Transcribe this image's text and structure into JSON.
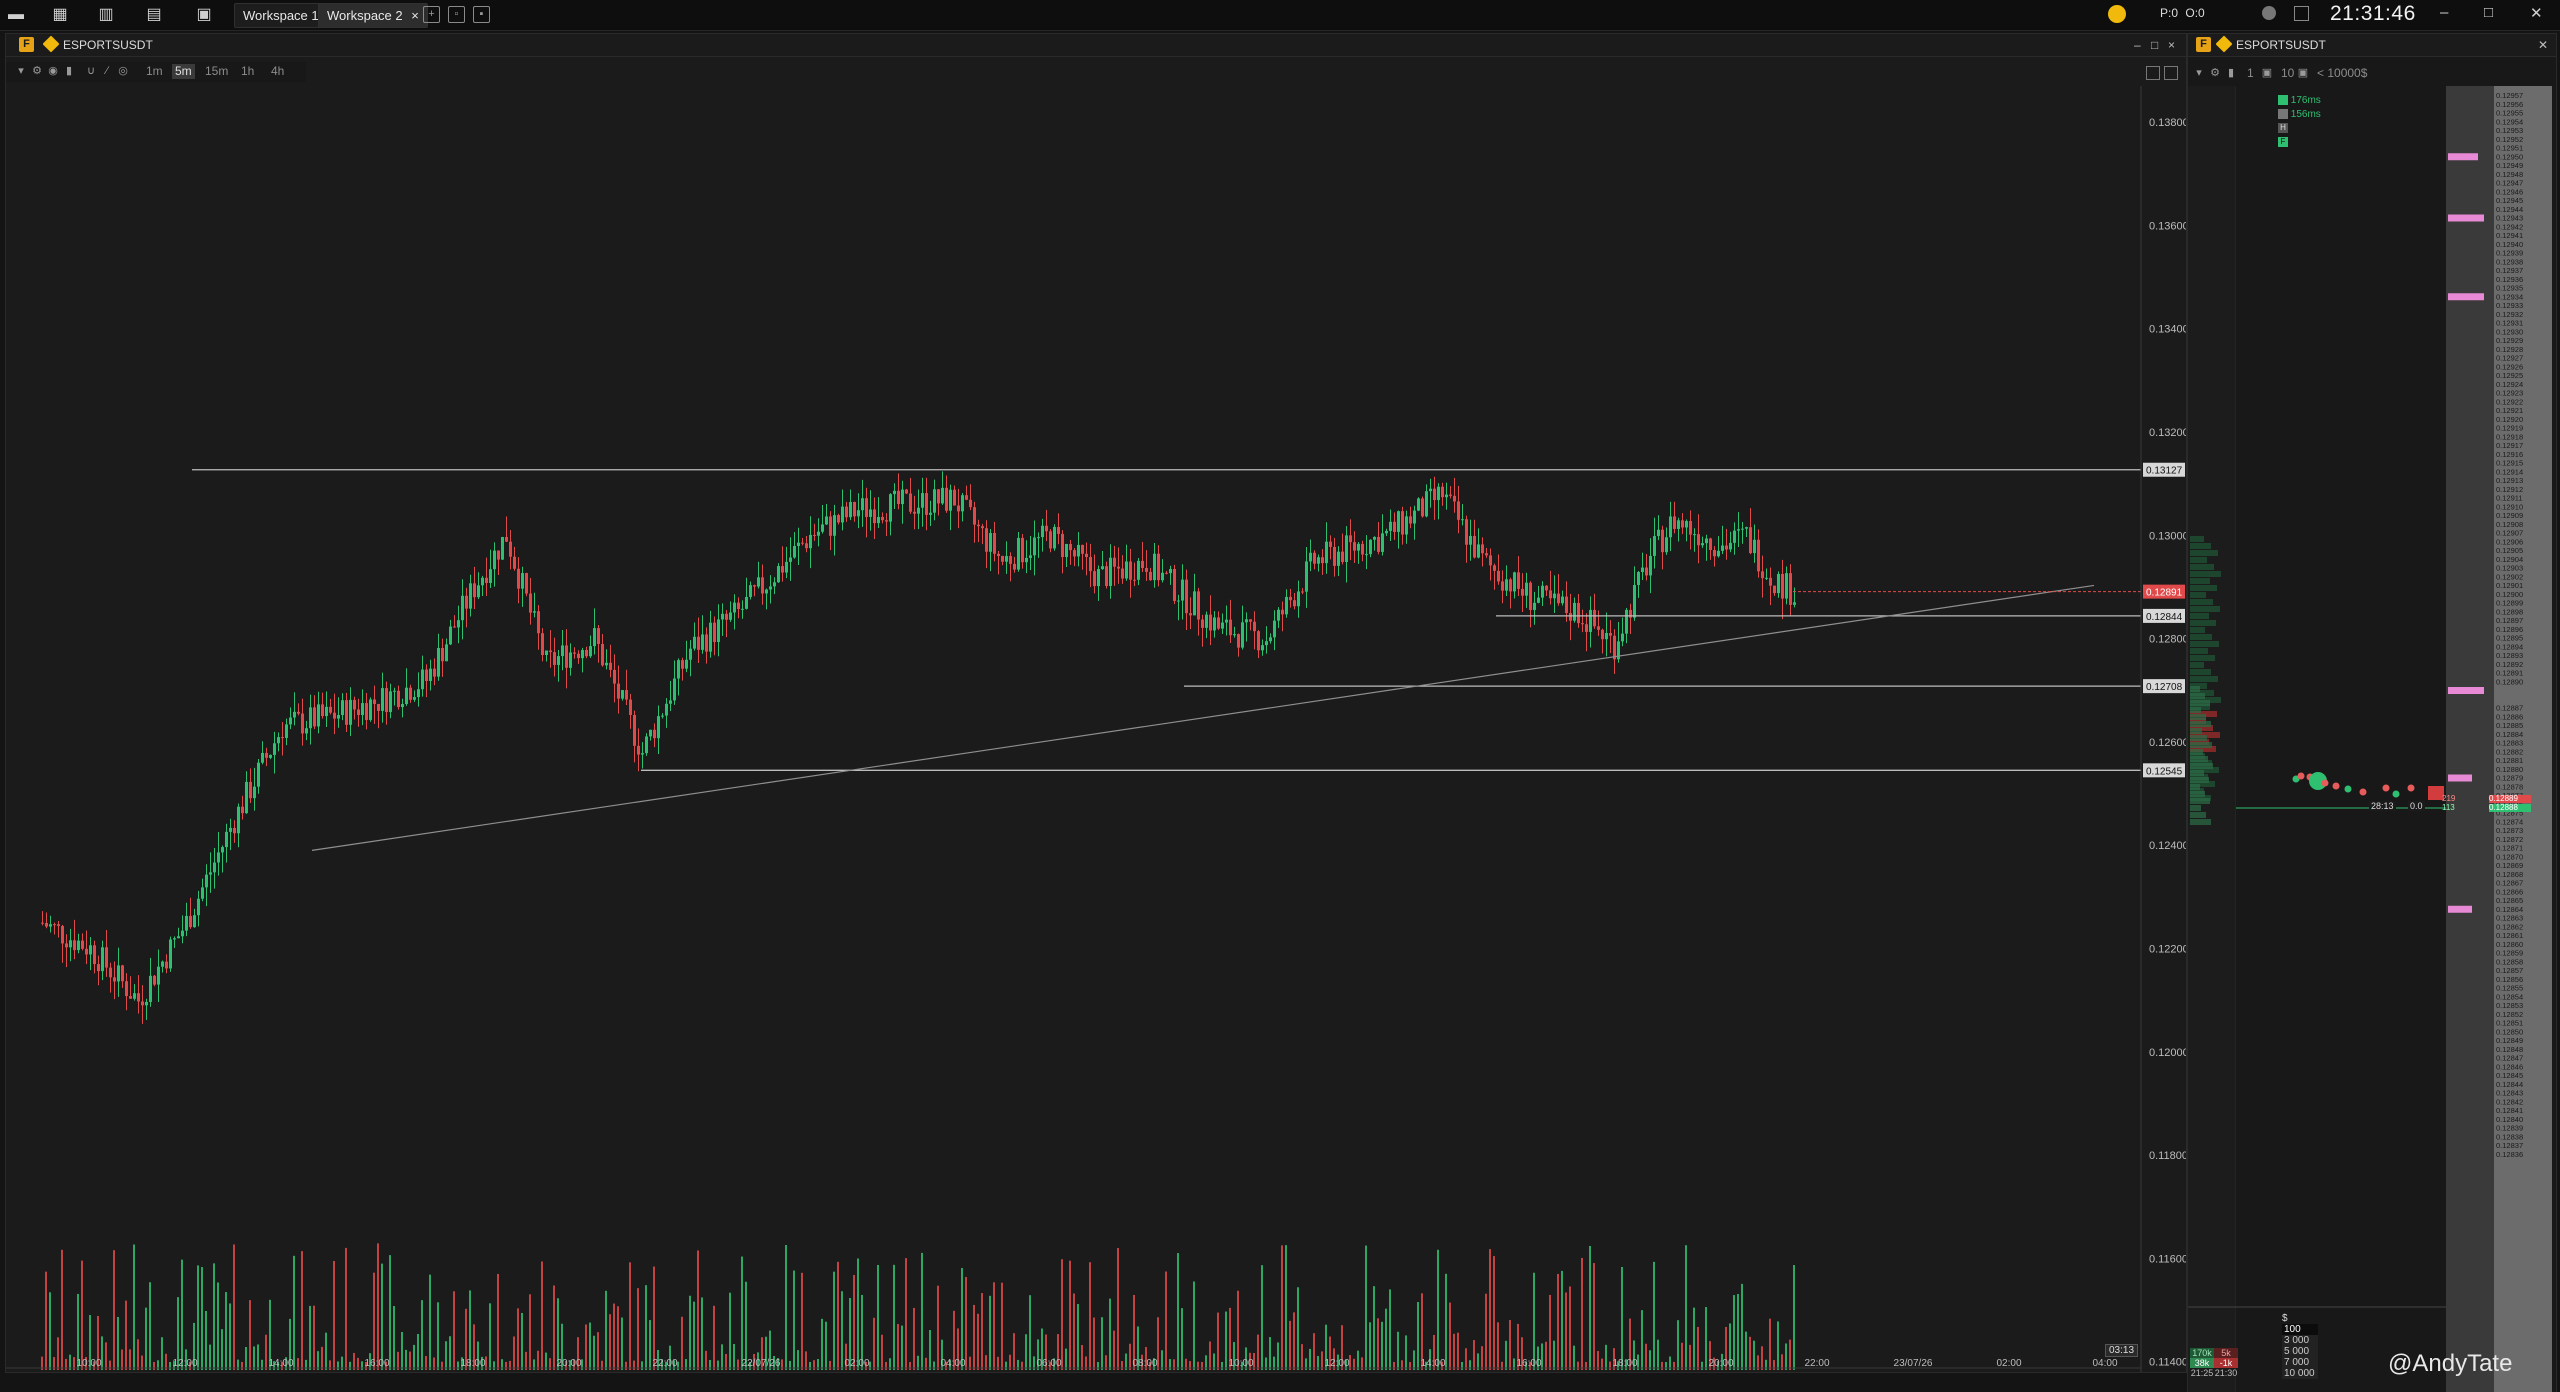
{
  "topbar": {
    "workspace_tabs": [
      "Workspace 1",
      "Workspace 2"
    ],
    "close_tab": "×",
    "status_p": "P:0",
    "status_o": "O:0",
    "clock": "21:31:46"
  },
  "chart_panel": {
    "symbol": "ESPORTSUSDT",
    "badge": "F",
    "timeframes": [
      "1m",
      "5m",
      "15m",
      "1h",
      "4h"
    ],
    "active_timeframe": "5m",
    "window_controls": [
      "–",
      "□",
      "×"
    ],
    "countdown": "03:13"
  },
  "dom_panel": {
    "symbol": "ESPORTSUSDT",
    "badge": "F",
    "toolbar_values": [
      "1",
      "10"
    ],
    "min_size": "< 10000$",
    "latency_1": "176ms",
    "latency_2": "156ms",
    "key_h": "H",
    "key_f": "F",
    "timer": "28:13",
    "timer_value": "0.0",
    "best_ask": "0.12889",
    "best_bid": "0.12888",
    "ask_size": "219",
    "bid_size": "113",
    "cluster_times": [
      "21:25",
      "21:30"
    ],
    "cluster_vol_buy": [
      "170k",
      "5k"
    ],
    "cluster_vol_sell": [
      "38k",
      "-1k"
    ],
    "order_currency": "$",
    "order_sizes": [
      "100",
      "3 000",
      "5 000",
      "7 000",
      "10 000"
    ]
  },
  "watermark": "@AndyTate",
  "chart_data": {
    "type": "candlestick",
    "ylim": [
      0.1138,
      0.1387
    ],
    "price_ticks": [
      "0.13800",
      "0.13600",
      "0.13400",
      "0.13200",
      "0.13000",
      "0.12800",
      "0.12600",
      "0.12400",
      "0.12200",
      "0.12000",
      "0.11800",
      "0.11600",
      "0.11400"
    ],
    "time_ticks": [
      "10:00",
      "12:00",
      "14:00",
      "16:00",
      "18:00",
      "20:00",
      "22:00",
      "22/07/26",
      "02:00",
      "04:00",
      "06:00",
      "08:00",
      "10:00",
      "12:00",
      "14:00",
      "16:00",
      "18:00",
      "20:00",
      "22:00",
      "23/07/26",
      "02:00",
      "04:00"
    ],
    "price_key_points": [
      {
        "t": "09:00",
        "p": 0.1225
      },
      {
        "t": "10:00",
        "p": 0.122
      },
      {
        "t": "11:00",
        "p": 0.121
      },
      {
        "t": "12:00",
        "p": 0.1225
      },
      {
        "t": "13:00",
        "p": 0.1245
      },
      {
        "t": "14:00",
        "p": 0.1263
      },
      {
        "t": "15:00",
        "p": 0.1265
      },
      {
        "t": "16:00",
        "p": 0.1268
      },
      {
        "t": "17:00",
        "p": 0.1272
      },
      {
        "t": "18:00",
        "p": 0.129
      },
      {
        "t": "18:40",
        "p": 0.13
      },
      {
        "t": "19:30",
        "p": 0.1275
      },
      {
        "t": "20:30",
        "p": 0.128
      },
      {
        "t": "21:30",
        "p": 0.1258
      },
      {
        "t": "22:30",
        "p": 0.1278
      },
      {
        "t": "23:30",
        "p": 0.1285
      },
      {
        "t": "01:00",
        "p": 0.13
      },
      {
        "t": "02:00",
        "p": 0.1305
      },
      {
        "t": "04:00",
        "p": 0.1307
      },
      {
        "t": "05:00",
        "p": 0.1295
      },
      {
        "t": "06:00",
        "p": 0.13
      },
      {
        "t": "07:00",
        "p": 0.1292
      },
      {
        "t": "08:00",
        "p": 0.1295
      },
      {
        "t": "09:30",
        "p": 0.1282
      },
      {
        "t": "10:30",
        "p": 0.128
      },
      {
        "t": "11:30",
        "p": 0.1295
      },
      {
        "t": "13:00",
        "p": 0.13
      },
      {
        "t": "14:10",
        "p": 0.1308
      },
      {
        "t": "15:00",
        "p": 0.1295
      },
      {
        "t": "16:00",
        "p": 0.1288
      },
      {
        "t": "17:00",
        "p": 0.1285
      },
      {
        "t": "17:45",
        "p": 0.1279
      },
      {
        "t": "18:30",
        "p": 0.1296
      },
      {
        "t": "19:00",
        "p": 0.1303
      },
      {
        "t": "20:00",
        "p": 0.1298
      },
      {
        "t": "20:30",
        "p": 0.13
      },
      {
        "t": "21:00",
        "p": 0.1292
      },
      {
        "t": "21:30",
        "p": 0.1289
      }
    ],
    "horizontal_levels": [
      {
        "price": 0.13127,
        "label": "0.13127"
      },
      {
        "price": 0.12844,
        "label": "0.12844"
      },
      {
        "price": 0.12708,
        "label": "0.12708"
      },
      {
        "price": 0.12545,
        "label": "0.12545"
      }
    ],
    "last_price_label": "0.12891",
    "dom_price_levels": [
      "0.12957",
      "0.12956",
      "0.12955",
      "0.12954",
      "0.12953",
      "0.12952",
      "0.12951",
      "0.12950",
      "0.12949",
      "0.12948",
      "0.12947",
      "0.12946",
      "0.12945",
      "0.12944",
      "0.12943",
      "0.12942",
      "0.12941",
      "0.12940",
      "0.12939",
      "0.12938",
      "0.12937",
      "0.12936",
      "0.12935",
      "0.12934",
      "0.12933",
      "0.12932",
      "0.12931",
      "0.12930",
      "0.12929",
      "0.12928",
      "0.12927",
      "0.12926",
      "0.12925",
      "0.12924",
      "0.12923",
      "0.12922",
      "0.12921",
      "0.12920",
      "0.12919",
      "0.12918",
      "0.12917",
      "0.12916",
      "0.12915",
      "0.12914",
      "0.12913",
      "0.12912",
      "0.12911",
      "0.12910",
      "0.12909",
      "0.12908",
      "0.12907",
      "0.12906",
      "0.12905",
      "0.12904",
      "0.12903",
      "0.12902",
      "0.12901",
      "0.12900",
      "0.12899",
      "0.12898",
      "0.12897",
      "0.12896",
      "0.12895",
      "0.12894",
      "0.12893",
      "0.12892",
      "0.12891",
      "0.12890",
      "0.12889",
      "0.12888",
      "0.12887",
      "0.12886",
      "0.12885",
      "0.12884",
      "0.12883",
      "0.12882",
      "0.12881",
      "0.12880",
      "0.12879",
      "0.12878",
      "0.12877",
      "0.12876",
      "0.12875",
      "0.12874",
      "0.12873",
      "0.12872",
      "0.12871",
      "0.12870",
      "0.12869",
      "0.12868",
      "0.12867",
      "0.12866",
      "0.12865",
      "0.12864",
      "0.12863",
      "0.12862",
      "0.12861",
      "0.12860",
      "0.12859",
      "0.12858",
      "0.12857",
      "0.12856",
      "0.12855",
      "0.12854",
      "0.12853",
      "0.12852",
      "0.12851",
      "0.12850",
      "0.12849",
      "0.12848",
      "0.12847",
      "0.12846",
      "0.12845",
      "0.12844",
      "0.12843",
      "0.12842",
      "0.12841",
      "0.12840",
      "0.12839",
      "0.12838",
      "0.12837",
      "0.12836"
    ]
  },
  "colors": {
    "up": "#2fbf71",
    "down": "#e04a4a",
    "level_line": "#bdbdbd",
    "trend_line": "#8f8f8f"
  }
}
